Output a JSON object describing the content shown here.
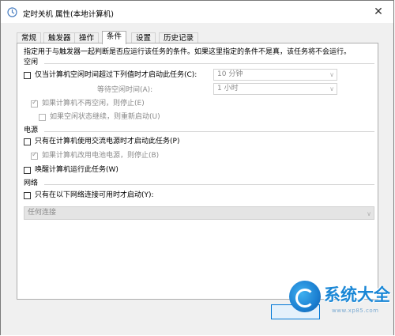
{
  "window": {
    "title": "定时关机 属性(本地计算机)",
    "close_glyph": "✕"
  },
  "tabs": [
    {
      "label": "常规"
    },
    {
      "label": "触发器"
    },
    {
      "label": "操作"
    },
    {
      "label": "条件",
      "active": true
    },
    {
      "label": "设置"
    },
    {
      "label": "历史记录"
    }
  ],
  "conditions": {
    "description": "指定用于与触发器一起判断是否应运行该任务的条件。如果这里指定的条件不是真，该任务将不会运行。",
    "idle": {
      "group_label": "空闲",
      "start_if_idle": {
        "label": "仅当计算机空闲时间超过下列值时才启动此任务(C):",
        "checked": false
      },
      "idle_duration": {
        "value": "10 分钟"
      },
      "wait_label": "等待空闲时间(A):",
      "wait_duration": {
        "value": "1 小时"
      },
      "stop_if_not_idle": {
        "label": "如果计算机不再空闲，则停止(E)",
        "checked": true
      },
      "restart_if_idle": {
        "label": "如果空闲状态继续，则重新启动(U)",
        "checked": false
      }
    },
    "power": {
      "group_label": "电源",
      "ac_only": {
        "label": "只有在计算机使用交流电源时才启动此任务(P)",
        "checked": false
      },
      "stop_on_battery": {
        "label": "如果计算机改用电池电源，则停止(B)",
        "checked": true
      },
      "wake": {
        "label": "唤醒计算机运行此任务(W)",
        "checked": false
      }
    },
    "network": {
      "group_label": "网络",
      "start_if_network": {
        "label": "只有在以下网络连接可用时才启动(Y):",
        "checked": false
      },
      "connection": {
        "value": "任何连接"
      }
    }
  },
  "watermark": {
    "text": "系统大全",
    "url": "www.xp85.com",
    "accent": "#1a87d6"
  },
  "colors": {
    "dialog_bg": "#f0f0f0",
    "ok_border": "#0078d7",
    "disabled_text": "#8a8a8a"
  }
}
